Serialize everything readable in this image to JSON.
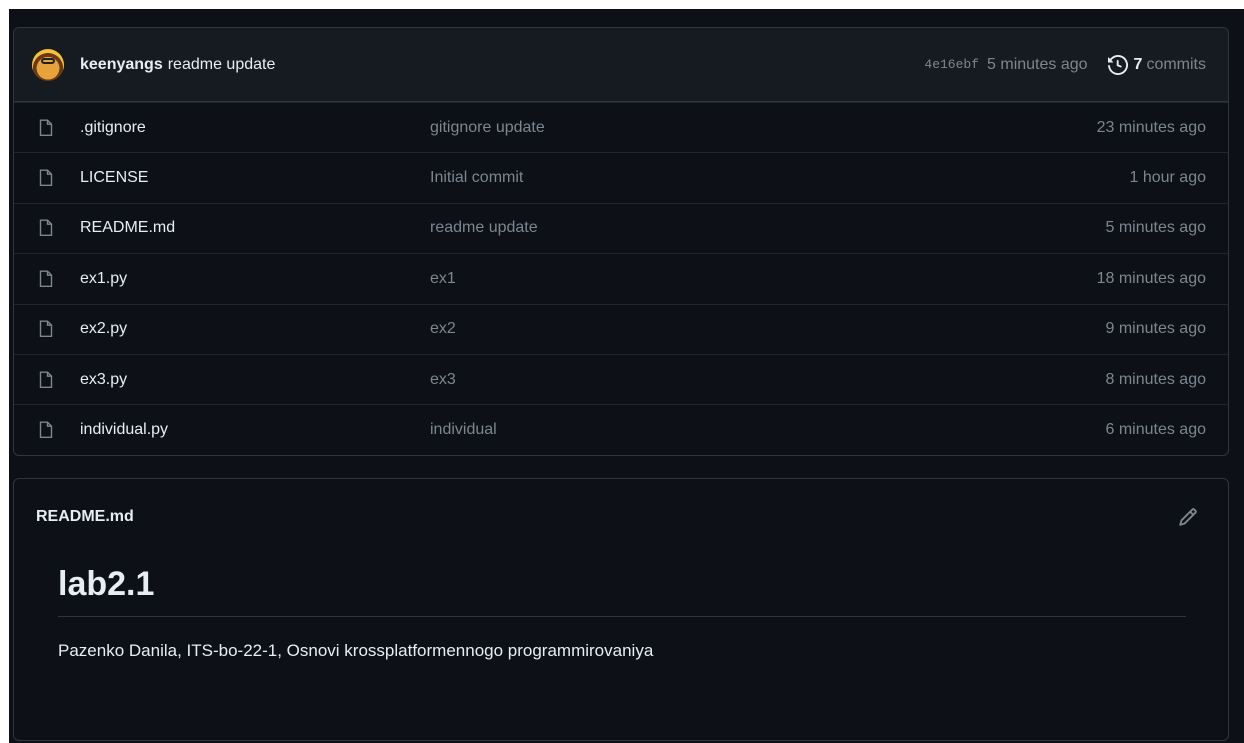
{
  "last_commit": {
    "author": "keenyangs",
    "message": "readme update",
    "sha": "4e16ebf",
    "time": "5 minutes ago",
    "commits_count": "7",
    "commits_label": "commits"
  },
  "files": [
    {
      "name": ".gitignore",
      "message": "gitignore update",
      "time": "23 minutes ago"
    },
    {
      "name": "LICENSE",
      "message": "Initial commit",
      "time": "1 hour ago"
    },
    {
      "name": "README.md",
      "message": "readme update",
      "time": "5 minutes ago"
    },
    {
      "name": "ex1.py",
      "message": "ex1",
      "time": "18 minutes ago"
    },
    {
      "name": "ex2.py",
      "message": "ex2",
      "time": "9 minutes ago"
    },
    {
      "name": "ex3.py",
      "message": "ex3",
      "time": "8 minutes ago"
    },
    {
      "name": "individual.py",
      "message": "individual",
      "time": "6 minutes ago"
    }
  ],
  "readme": {
    "filename": "README.md",
    "heading": "lab2.1",
    "text": "Pazenko Danila, ITS-bo-22-1, Osnovi krossplatformennogo programmirovaniya"
  },
  "icons": {
    "file": "file-icon",
    "history": "history-icon",
    "edit": "pencil-icon"
  },
  "colors": {
    "background": "#0d1117",
    "header_bg": "#161b22",
    "border": "#30363d",
    "text": "#e6edf3",
    "muted": "#7d8590"
  }
}
